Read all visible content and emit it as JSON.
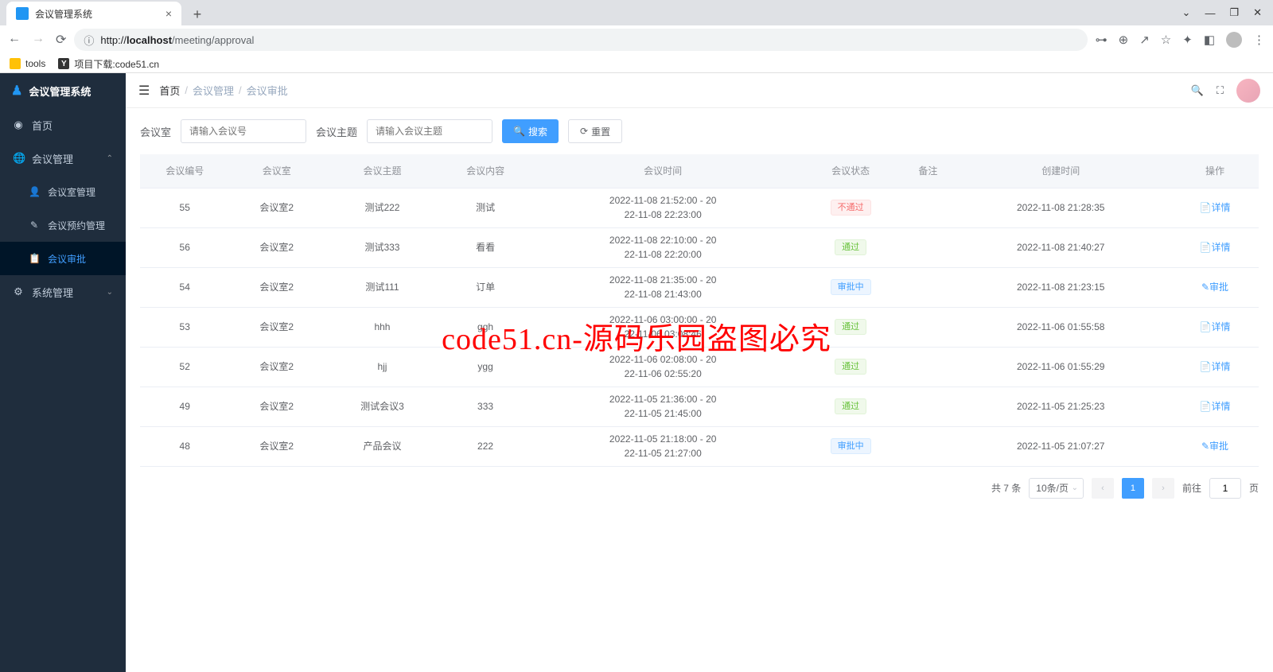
{
  "browser": {
    "tab_title": "会议管理系统",
    "url_info_icon": "ⓘ",
    "url_host": "localhost",
    "url_path": "/meeting/approval",
    "url_full": "http://localhost/meeting/approval",
    "bookmarks": [
      {
        "label": "tools"
      },
      {
        "label": "项目下载:code51.cn"
      }
    ]
  },
  "app": {
    "brand": "会议管理系统",
    "menu": {
      "home": "首页",
      "meeting_mgmt": "会议管理",
      "room_mgmt": "会议室管理",
      "booking_mgmt": "会议预约管理",
      "approval": "会议审批",
      "sys_mgmt": "系统管理"
    },
    "breadcrumb": {
      "home": "首页",
      "l1": "会议管理",
      "l2": "会议审批"
    },
    "filter": {
      "room_label": "会议室",
      "room_placeholder": "请输入会议号",
      "topic_label": "会议主题",
      "topic_placeholder": "请输入会议主题",
      "search_btn": "搜索",
      "reset_btn": "重置"
    },
    "table": {
      "headers": [
        "会议编号",
        "会议室",
        "会议主题",
        "会议内容",
        "会议时间",
        "会议状态",
        "备注",
        "创建时间",
        "操作"
      ],
      "rows": [
        {
          "id": "55",
          "room": "会议室2",
          "topic": "测试222",
          "content": "测试",
          "time": "2022-11-08 21:52:00 - 2022-11-08 22:23:00",
          "status": "不通过",
          "status_type": "danger",
          "remark": "",
          "created": "2022-11-08 21:28:35",
          "action": "详情",
          "action_type": "detail"
        },
        {
          "id": "56",
          "room": "会议室2",
          "topic": "测试333",
          "content": "看看",
          "time": "2022-11-08 22:10:00 - 2022-11-08 22:20:00",
          "status": "通过",
          "status_type": "success",
          "remark": "",
          "created": "2022-11-08 21:40:27",
          "action": "详情",
          "action_type": "detail"
        },
        {
          "id": "54",
          "room": "会议室2",
          "topic": "测试111",
          "content": "订单",
          "time": "2022-11-08 21:35:00 - 2022-11-08 21:43:00",
          "status": "审批中",
          "status_type": "info",
          "remark": "",
          "created": "2022-11-08 21:23:15",
          "action": "审批",
          "action_type": "approve"
        },
        {
          "id": "53",
          "room": "会议室2",
          "topic": "hhh",
          "content": "ggh",
          "time": "2022-11-06 03:00:00 - 2022-11-06 03:08:46",
          "status": "通过",
          "status_type": "success",
          "remark": "",
          "created": "2022-11-06 01:55:58",
          "action": "详情",
          "action_type": "detail"
        },
        {
          "id": "52",
          "room": "会议室2",
          "topic": "hjj",
          "content": "ygg",
          "time": "2022-11-06 02:08:00 - 2022-11-06 02:55:20",
          "status": "通过",
          "status_type": "success",
          "remark": "",
          "created": "2022-11-06 01:55:29",
          "action": "详情",
          "action_type": "detail"
        },
        {
          "id": "49",
          "room": "会议室2",
          "topic": "测试会议3",
          "content": "333",
          "time": "2022-11-05 21:36:00 - 2022-11-05 21:45:00",
          "status": "通过",
          "status_type": "success",
          "remark": "",
          "created": "2022-11-05 21:25:23",
          "action": "详情",
          "action_type": "detail"
        },
        {
          "id": "48",
          "room": "会议室2",
          "topic": "产品会议",
          "content": "222",
          "time": "2022-11-05 21:18:00 - 2022-11-05 21:27:00",
          "status": "审批中",
          "status_type": "info",
          "remark": "",
          "created": "2022-11-05 21:07:27",
          "action": "审批",
          "action_type": "approve"
        }
      ]
    },
    "pagination": {
      "total_text": "共 7 条",
      "page_size": "10条/页",
      "current": "1",
      "goto_label": "前往",
      "goto_value": "1",
      "page_suffix": "页"
    }
  },
  "watermark": "code51.cn-源码乐园盗图必究"
}
